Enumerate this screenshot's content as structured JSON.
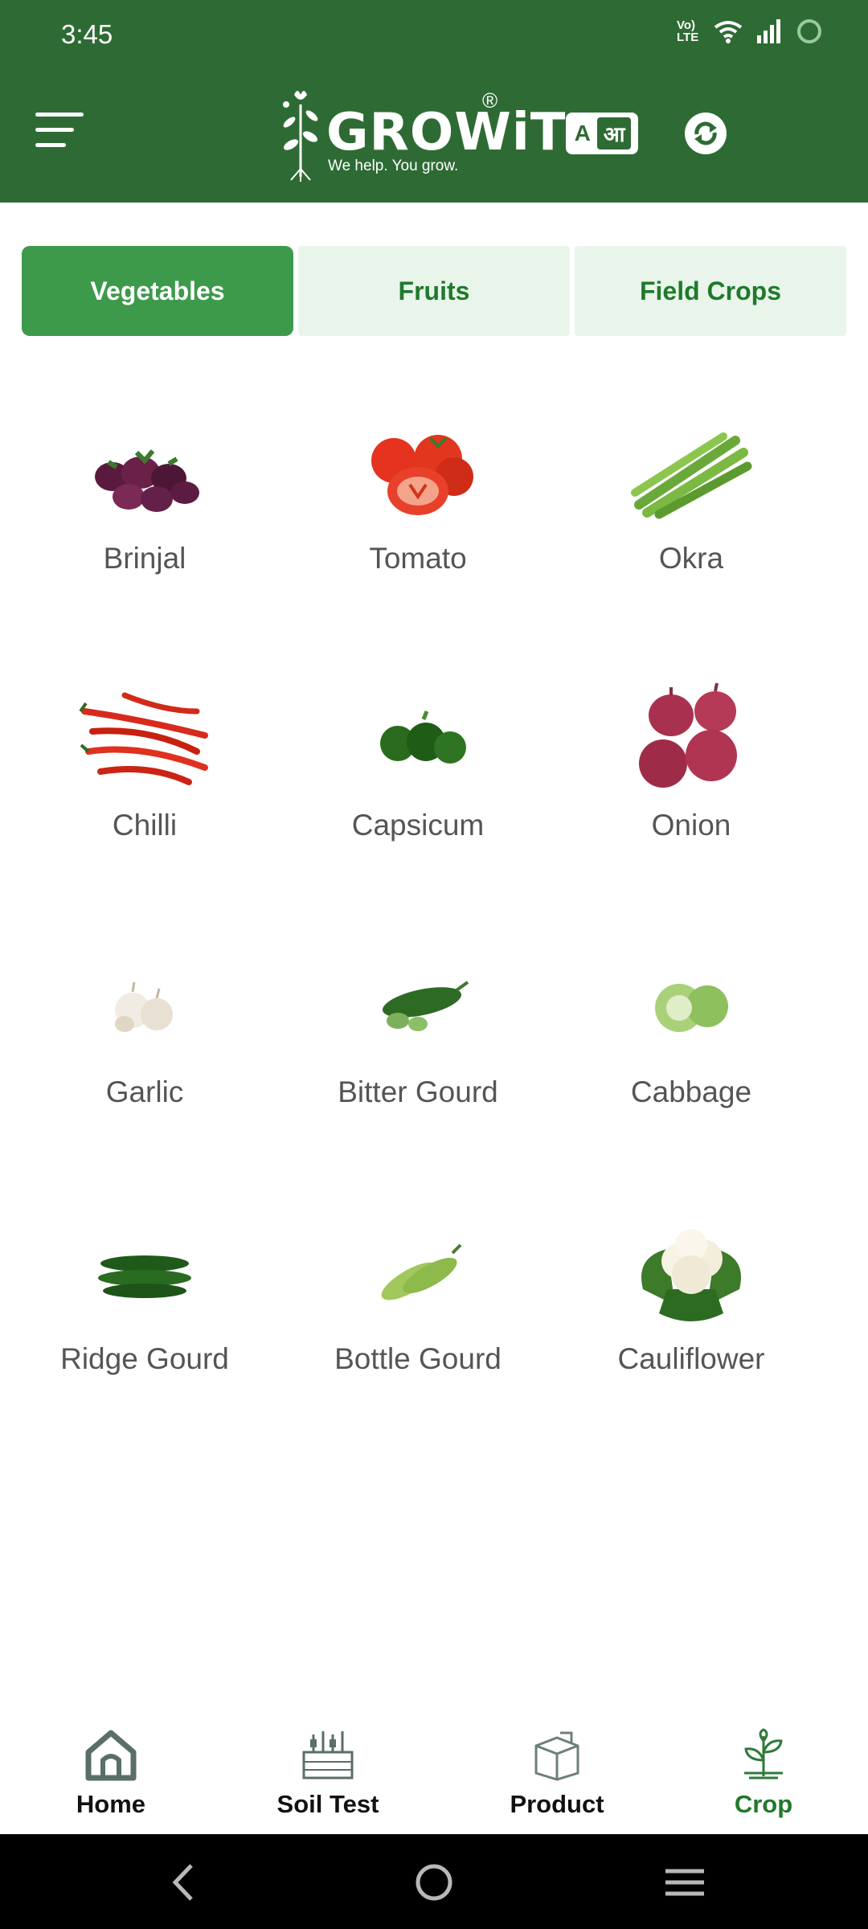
{
  "status_bar": {
    "time": "3:45",
    "network_label": "Vo) LTE"
  },
  "header": {
    "logo_word": "GROWiT",
    "logo_reg": "®",
    "tagline": "We help. You grow.",
    "lang_a": "A",
    "lang_hi": "आ"
  },
  "tabs": [
    {
      "label": "Vegetables",
      "active": true
    },
    {
      "label": "Fruits",
      "active": false
    },
    {
      "label": "Field Crops",
      "active": false
    }
  ],
  "crops": [
    {
      "label": "Brinjal",
      "icon": "brinjal-icon"
    },
    {
      "label": "Tomato",
      "icon": "tomato-icon"
    },
    {
      "label": "Okra",
      "icon": "okra-icon"
    },
    {
      "label": "Chilli",
      "icon": "chilli-icon"
    },
    {
      "label": "Capsicum",
      "icon": "capsicum-icon"
    },
    {
      "label": "Onion",
      "icon": "onion-icon"
    },
    {
      "label": "Garlic",
      "icon": "garlic-icon"
    },
    {
      "label": "Bitter Gourd",
      "icon": "bitter-gourd-icon"
    },
    {
      "label": "Cabbage",
      "icon": "cabbage-icon"
    },
    {
      "label": "Ridge Gourd",
      "icon": "ridge-gourd-icon"
    },
    {
      "label": "Bottle Gourd",
      "icon": "bottle-gourd-icon"
    },
    {
      "label": "Cauliflower",
      "icon": "cauliflower-icon"
    }
  ],
  "bottom_nav": [
    {
      "label": "Home",
      "icon": "home-icon",
      "active": false
    },
    {
      "label": "Soil Test",
      "icon": "soil-test-icon",
      "active": false
    },
    {
      "label": "Product",
      "icon": "product-box-icon",
      "active": false
    },
    {
      "label": "Crop",
      "icon": "crop-plant-icon",
      "active": true
    }
  ],
  "colors": {
    "header_bg": "#2e6b34",
    "tab_active": "#3d9a4b",
    "tab_inactive": "#e9f5eb",
    "accent_text": "#1f7a2b"
  }
}
